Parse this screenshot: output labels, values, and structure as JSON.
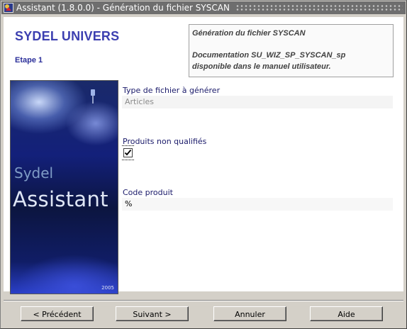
{
  "window": {
    "title": "Assistant (1.8.0.0) - Génération du fichier SYSCAN",
    "icon": "app-icon"
  },
  "header": {
    "brand": "SYDEL UNIVERS",
    "step": "Etape 1",
    "info_title": "Génération du fichier SYSCAN",
    "info_doc_line1": "Documentation SU_WIZ_SP_SYSCAN_sp",
    "info_doc_line2": "disponible dans le manuel utilisateur."
  },
  "splash": {
    "word1": "Sydel",
    "word2": "Assistant",
    "year": "2005"
  },
  "form": {
    "file_type_label": "Type de fichier à générer",
    "file_type_value": "Articles",
    "unqualified_label": "Produits non qualifiés",
    "unqualified_checked": true,
    "product_code_label": "Code produit",
    "product_code_value": "%"
  },
  "buttons": {
    "previous": "< Précédent",
    "next": "Suivant >",
    "cancel": "Annuler",
    "help": "Aide"
  }
}
